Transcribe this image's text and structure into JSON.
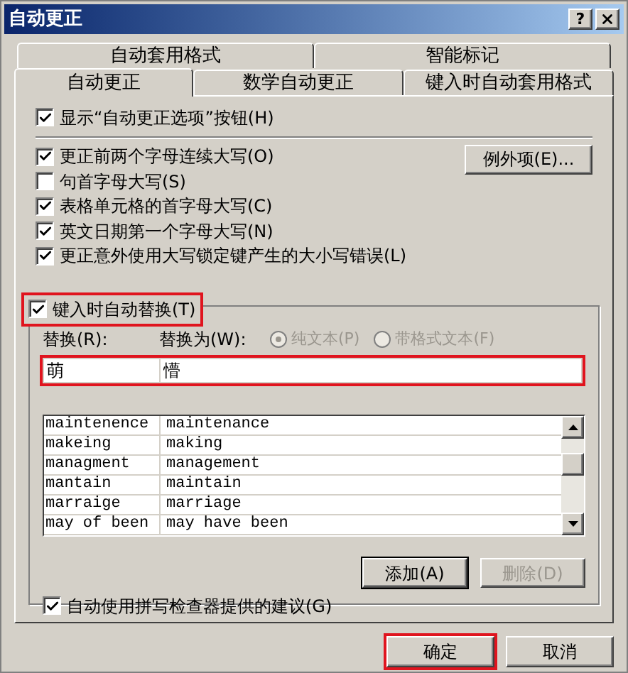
{
  "window": {
    "title": "自动更正",
    "help": "?"
  },
  "tab_rows": [
    {
      "tabs": [
        {
          "label": "自动套用格式",
          "selected": false
        },
        {
          "label": "智能标记",
          "selected": false
        }
      ]
    },
    {
      "tabs": [
        {
          "label": "自动更正",
          "selected": true
        },
        {
          "label": "数学自动更正",
          "selected": false
        },
        {
          "label": "键入时自动套用格式",
          "selected": false
        }
      ]
    }
  ],
  "show_button_option": {
    "label": "显示“自动更正选项”按钮(H)",
    "checked": true
  },
  "options": [
    {
      "label": "更正前两个字母连续大写(O)",
      "checked": true
    },
    {
      "label": "句首字母大写(S)",
      "checked": false
    },
    {
      "label": "表格单元格的首字母大写(C)",
      "checked": true
    },
    {
      "label": "英文日期第一个字母大写(N)",
      "checked": true
    },
    {
      "label": "更正意外使用大写锁定键产生的大小写错误(L)",
      "checked": true
    }
  ],
  "exceptions_button": {
    "label": "例外项(E)..."
  },
  "auto_replace": {
    "label": "键入时自动替换(T)",
    "checked": true,
    "highlighted": true,
    "replace_label": "替换(R):",
    "with_label": "替换为(W):",
    "formats": [
      {
        "label": "纯文本(P)",
        "selected": true,
        "disabled": true
      },
      {
        "label": "带格式文本(F)",
        "selected": false,
        "disabled": true
      }
    ],
    "replace_value": "萌",
    "with_value": "懵",
    "fields_highlighted": true,
    "rows": [
      {
        "from": "maintenence",
        "to": "maintenance"
      },
      {
        "from": "makeing",
        "to": "making"
      },
      {
        "from": "managment",
        "to": "management"
      },
      {
        "from": "mantain",
        "to": "maintain"
      },
      {
        "from": "marraige",
        "to": "marriage"
      },
      {
        "from": "may of been",
        "to": "may have been"
      }
    ],
    "add_button": {
      "label": "添加(A)",
      "disabled": false
    },
    "delete_button": {
      "label": "删除(D)",
      "disabled": true
    },
    "spell_option": {
      "label": "自动使用拼写检查器提供的建议(G)",
      "checked": true
    }
  },
  "buttons": [
    {
      "label": "确定",
      "highlighted": true
    },
    {
      "label": "取消",
      "highlighted": false
    }
  ]
}
